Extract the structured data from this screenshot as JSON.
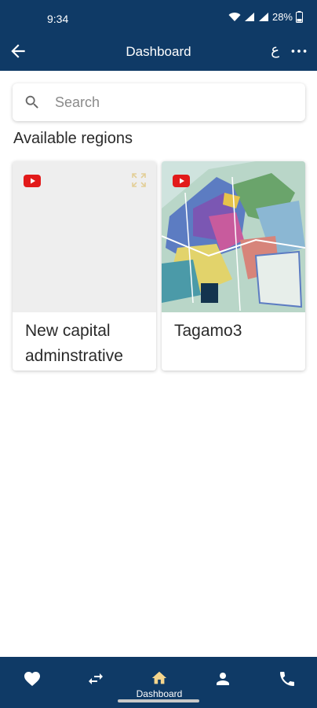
{
  "status_bar": {
    "time": "9:34",
    "battery": "28%"
  },
  "app_bar": {
    "title": "Dashboard",
    "lang_label": "ع"
  },
  "search": {
    "placeholder": "Search"
  },
  "section_title": "Available regions",
  "regions": [
    {
      "name": "New capital adminstrative"
    },
    {
      "name": "Tagamo3"
    }
  ],
  "bottom_nav": {
    "items": [
      {
        "icon": "heart-icon",
        "label": ""
      },
      {
        "icon": "swap-icon",
        "label": ""
      },
      {
        "icon": "home-icon",
        "label": "Dashboard",
        "active": true
      },
      {
        "icon": "person-icon",
        "label": ""
      },
      {
        "icon": "phone-icon",
        "label": ""
      }
    ]
  },
  "colors": {
    "primary": "#0f3a66",
    "active_nav": "#f4d58d",
    "youtube": "#e21a1a",
    "expand_icon": "#e3cf99"
  }
}
